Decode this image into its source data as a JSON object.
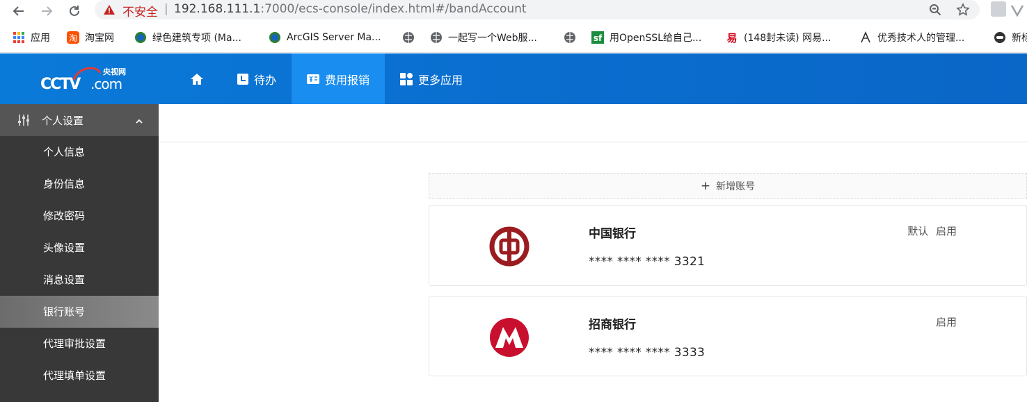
{
  "browser": {
    "insecure_label": "不安全",
    "separator": "|",
    "url_host": "192.168.111.1",
    "url_path": ":7000/ecs-console/index.html#/bandAccount",
    "bookmarks": [
      {
        "icon": "apps-icon",
        "label": "应用"
      },
      {
        "icon": "taobao-icon",
        "label": "淘宝网"
      },
      {
        "icon": "globe-icon",
        "label": "绿色建筑专项 (Ma..."
      },
      {
        "icon": "globe-icon",
        "label": "ArcGIS Server Ma..."
      },
      {
        "icon": "globe-icon",
        "label": ""
      },
      {
        "icon": "globe-icon",
        "label": "一起写一个Web服..."
      },
      {
        "icon": "globe-icon",
        "label": ""
      },
      {
        "icon": "sf-icon",
        "label": "用OpenSSL给自己..."
      },
      {
        "icon": "netease-icon",
        "label": "(148封未读) 网易..."
      },
      {
        "icon": "leaf-icon",
        "label": "优秀技术人的管理..."
      },
      {
        "icon": "circle-icon",
        "label": "新标"
      }
    ]
  },
  "header": {
    "logo_text": "央视网",
    "logo_cctv": "CCTV",
    "logo_com": ".com",
    "nav": [
      {
        "label": "",
        "icon": "home-icon"
      },
      {
        "label": "待办",
        "icon": "todo-icon"
      },
      {
        "label": "费用报销",
        "icon": "expense-icon",
        "active": true
      },
      {
        "label": "更多应用",
        "icon": "apps-grid-icon"
      }
    ]
  },
  "sidebar": {
    "group_label": "个人设置",
    "items": [
      "个人信息",
      "身份信息",
      "修改密码",
      "头像设置",
      "消息设置",
      "银行账号",
      "代理审批设置",
      "代理填单设置"
    ],
    "active_index": 5
  },
  "main": {
    "add_account_label": "新增账号",
    "accounts": [
      {
        "bank": "中国银行",
        "number": "**** **** **** 3321",
        "tags": [
          "默认",
          "启用"
        ],
        "logo": "boc-logo-icon",
        "color": "#9b1c20"
      },
      {
        "bank": "招商银行",
        "number": "**** **** **** 3333",
        "tags": [
          "启用"
        ],
        "logo": "cmb-logo-icon",
        "color": "#c8102e"
      }
    ]
  }
}
